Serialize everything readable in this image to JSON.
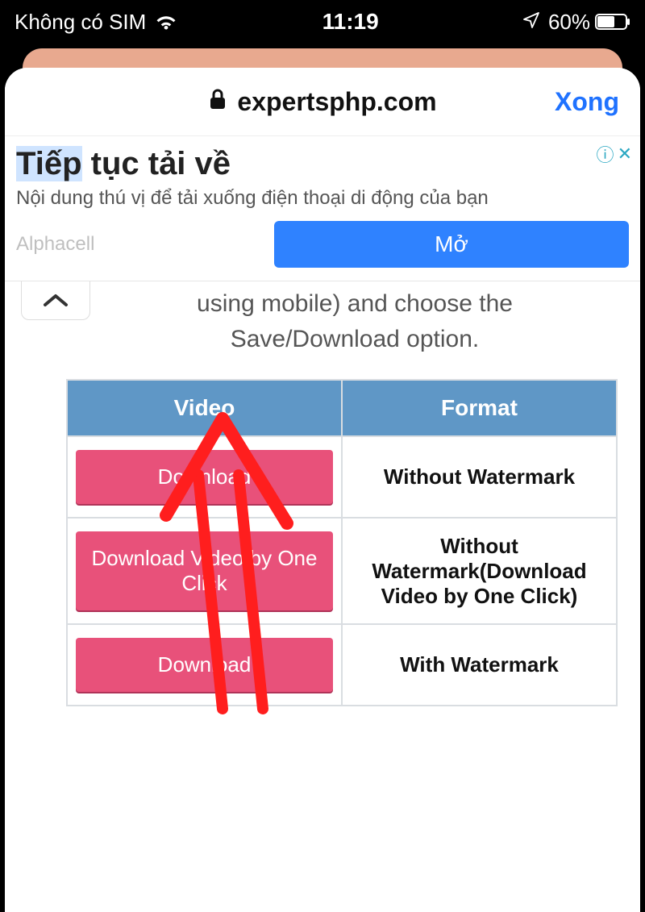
{
  "statusbar": {
    "carrier": "Không có SIM",
    "time": "11:19",
    "battery_pct": "60%"
  },
  "browser": {
    "domain": "expertsphp.com",
    "done_label": "Xong"
  },
  "ad": {
    "title_hl": "Tiếp",
    "title_rest": " tục tải về",
    "subtitle": "Nội dung thú vị để tải xuống điện thoại di động của bạn",
    "brand": "Alphacell",
    "cta": "Mở",
    "info_glyph": "ⓘ",
    "close_glyph": "✕"
  },
  "page": {
    "instruction_line1": "using mobile) and choose the",
    "instruction_line2": "Save/Download option."
  },
  "table": {
    "headers": {
      "video": "Video",
      "format": "Format"
    },
    "rows": [
      {
        "button": "Download",
        "format": "Without Watermark"
      },
      {
        "button": "Download Video by One Click",
        "format": "Without Watermark(Download Video by One Click)"
      },
      {
        "button": "Download",
        "format": "With Watermark"
      }
    ]
  }
}
